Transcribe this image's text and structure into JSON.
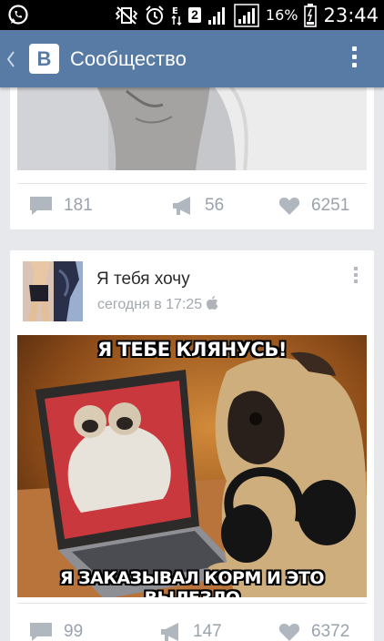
{
  "status_bar": {
    "icons": [
      "whatsapp-icon",
      "vibrate-icon",
      "alarm-icon",
      "edge-network-icon",
      "sim-badge",
      "signal-icon",
      "signal-icon",
      "battery-icon"
    ],
    "sim_slot": "2",
    "battery": "16%",
    "time": "23:44"
  },
  "app_bar": {
    "title": "Сообщество",
    "logo_letter": "В",
    "back_icon": "chevron-left-icon",
    "menu_icon": "overflow-menu-icon",
    "background": "#577ba5"
  },
  "post1": {
    "comments": "181",
    "reposts": "56",
    "likes": "6251"
  },
  "post2": {
    "title": "Я тебя хочу",
    "time": "сегодня в 17:25",
    "image_caption_top": "Я ТЕБЕ КЛЯНУСЬ!",
    "image_caption_bottom": "Я ЗАКАЗЫВАЛ КОРМ И ЭТО ВЫЛЕЗЛО",
    "comments": "99",
    "reposts": "147",
    "likes": "6372"
  },
  "colors": {
    "action_gray": "#9aa3ad",
    "feed_bg": "#e6e8ec"
  }
}
